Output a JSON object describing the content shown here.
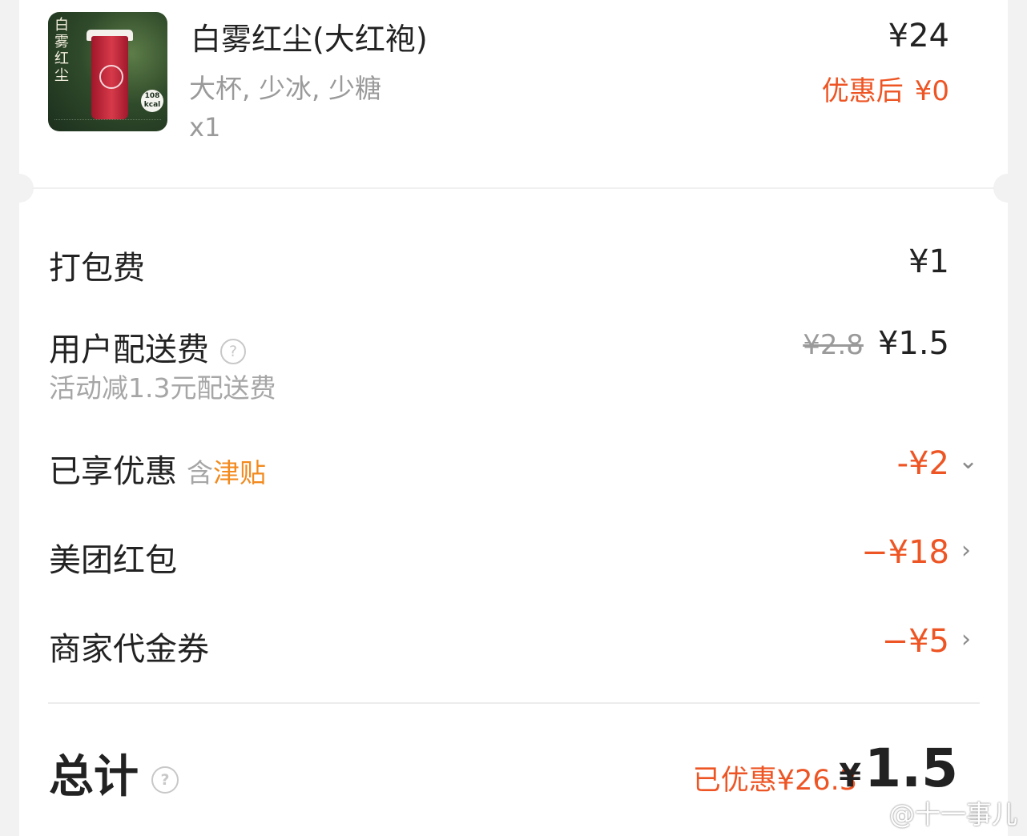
{
  "product": {
    "name": "白雾红尘(大红袍)",
    "specs": "大杯, 少冰, 少糖",
    "quantity": "x1",
    "price": "¥24",
    "discount_label": "优惠后",
    "discount_price": "¥0",
    "thumb_brand": "白雾红尘",
    "thumb_kcal": "108 kcal"
  },
  "fees": {
    "packing": {
      "label": "打包费",
      "amount": "¥1"
    },
    "delivery": {
      "label": "用户配送费",
      "original": "¥2.8",
      "amount": "¥1.5",
      "note": "活动减1.3元配送费"
    }
  },
  "discounts": {
    "enjoyed": {
      "label": "已享优惠",
      "hint_prefix": "含",
      "hint_highlight": "津贴",
      "amount": "-¥2"
    },
    "red_packet": {
      "label": "美团红包",
      "amount": "−¥18"
    },
    "voucher": {
      "label": "商家代金券",
      "amount": "−¥5"
    }
  },
  "total": {
    "label": "总计",
    "saved": "已优惠¥26.3",
    "currency": "¥",
    "amount": "1.5"
  },
  "watermark": "@十一事儿",
  "colors": {
    "accent_orange": "#ee5524",
    "subsidy_orange": "#f28a1e",
    "muted_text": "#9a9a9a"
  }
}
